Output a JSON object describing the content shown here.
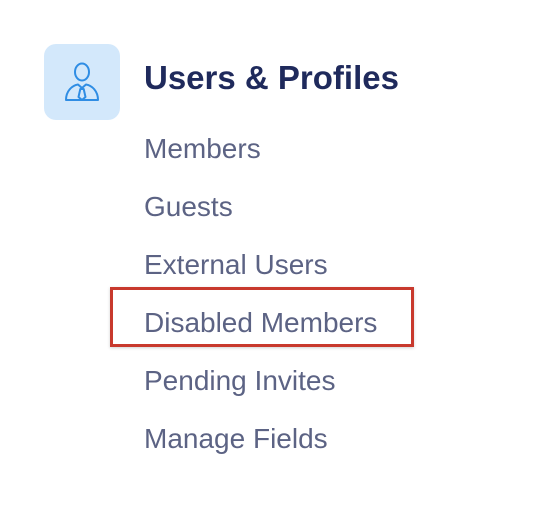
{
  "section": {
    "title": "Users & Profiles",
    "icon": "user-profile-icon"
  },
  "menu": {
    "items": [
      {
        "label": "Members"
      },
      {
        "label": "Guests"
      },
      {
        "label": "External Users"
      },
      {
        "label": "Disabled Members",
        "highlighted": true
      },
      {
        "label": "Pending Invites"
      },
      {
        "label": "Manage Fields"
      }
    ]
  },
  "colors": {
    "title": "#1f2a5c",
    "item_text": "#5c6384",
    "icon_tile_bg": "#d3e8fb",
    "icon_stroke": "#2f8de4",
    "highlight": "#c8392d"
  }
}
